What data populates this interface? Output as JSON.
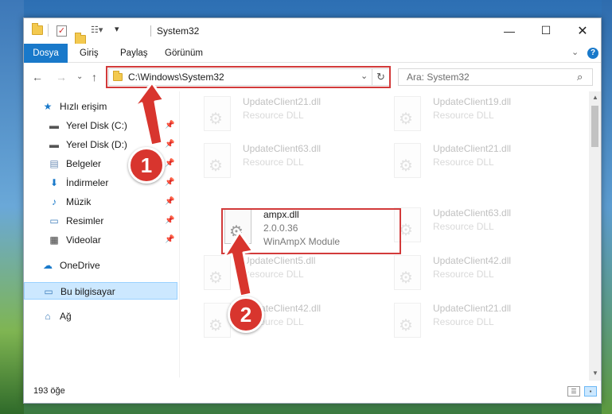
{
  "window": {
    "title": "System32"
  },
  "ribbon": {
    "tabs": [
      "Dosya",
      "Giriş",
      "Paylaş",
      "Görünüm"
    ]
  },
  "address": {
    "path": "C:\\Windows\\System32"
  },
  "search": {
    "placeholder": "Ara: System32"
  },
  "sidebar": {
    "items": [
      {
        "label": "Hızlı erişim",
        "icon": "star-icon"
      },
      {
        "label": "Yerel Disk (C:)",
        "icon": "drive-icon"
      },
      {
        "label": "Yerel Disk (D:)",
        "icon": "drive-icon"
      },
      {
        "label": "Belgeler",
        "icon": "document-icon"
      },
      {
        "label": "İndirmeler",
        "icon": "download-icon"
      },
      {
        "label": "Müzik",
        "icon": "music-icon"
      },
      {
        "label": "Resimler",
        "icon": "pictures-icon"
      },
      {
        "label": "Videolar",
        "icon": "video-icon"
      },
      {
        "label": "OneDrive",
        "icon": "cloud-icon"
      },
      {
        "label": "Bu bilgisayar",
        "icon": "computer-icon"
      },
      {
        "label": "Ağ",
        "icon": "network-icon"
      }
    ]
  },
  "files": [
    {
      "name": "UpdateClient21.dll",
      "desc": "Resource DLL"
    },
    {
      "name": "UpdateClient19.dll",
      "desc": "Resource DLL"
    },
    {
      "name": "UpdateClient63.dll",
      "desc": "Resource DLL"
    },
    {
      "name": "UpdateClient21.dll",
      "desc": "Resource DLL"
    },
    {
      "name": "ampx.dll",
      "version": "2.0.0.36",
      "desc": "WinAmpX Module"
    },
    {
      "name": "UpdateClient63.dll",
      "desc": "Resource DLL"
    },
    {
      "name": "UpdateClient5.dll",
      "desc": "Resource DLL"
    },
    {
      "name": "UpdateClient42.dll",
      "desc": "Resource DLL"
    },
    {
      "name": "UpdateClient42.dll",
      "desc": "Resource DLL"
    },
    {
      "name": "UpdateClient21.dll",
      "desc": "Resource DLL"
    }
  ],
  "status": {
    "count": "193 öğe"
  },
  "callouts": {
    "one": "1",
    "two": "2"
  },
  "colors": {
    "accent": "#1979ca",
    "highlight": "#d23a3a"
  }
}
